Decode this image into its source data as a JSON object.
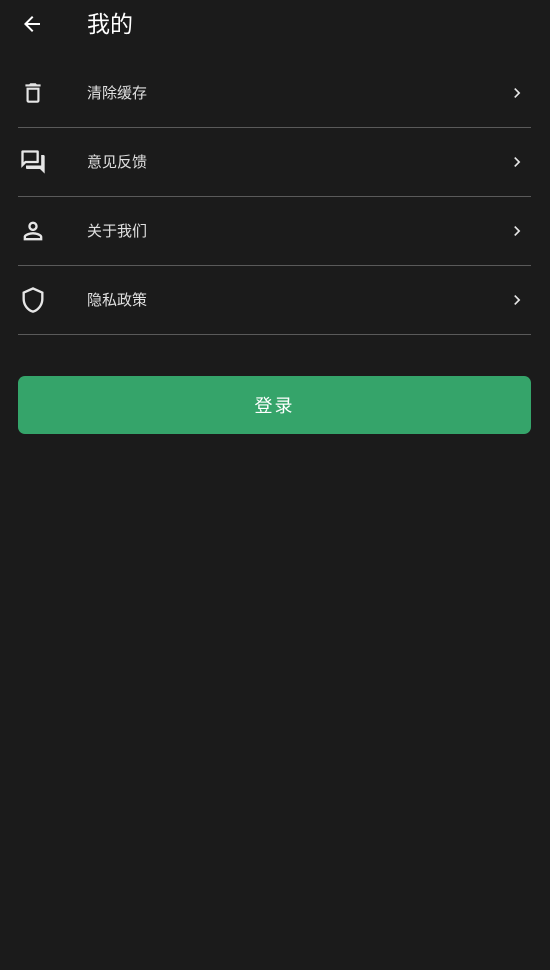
{
  "header": {
    "title": "我的",
    "back_icon": "arrow-back-icon"
  },
  "menu": {
    "items": [
      {
        "label": "清除缓存",
        "icon": "trash-icon"
      },
      {
        "label": "意见反馈",
        "icon": "forum-chat-icon"
      },
      {
        "label": "关于我们",
        "icon": "person-icon"
      },
      {
        "label": "隐私政策",
        "icon": "shield-icon"
      }
    ],
    "chevron_icon": "chevron-right-icon"
  },
  "login": {
    "label": "登录"
  },
  "colors": {
    "background": "#1b1b1b",
    "accent": "#35a46a",
    "divider": "#5a5a5a",
    "text": "#e0e0e0"
  }
}
